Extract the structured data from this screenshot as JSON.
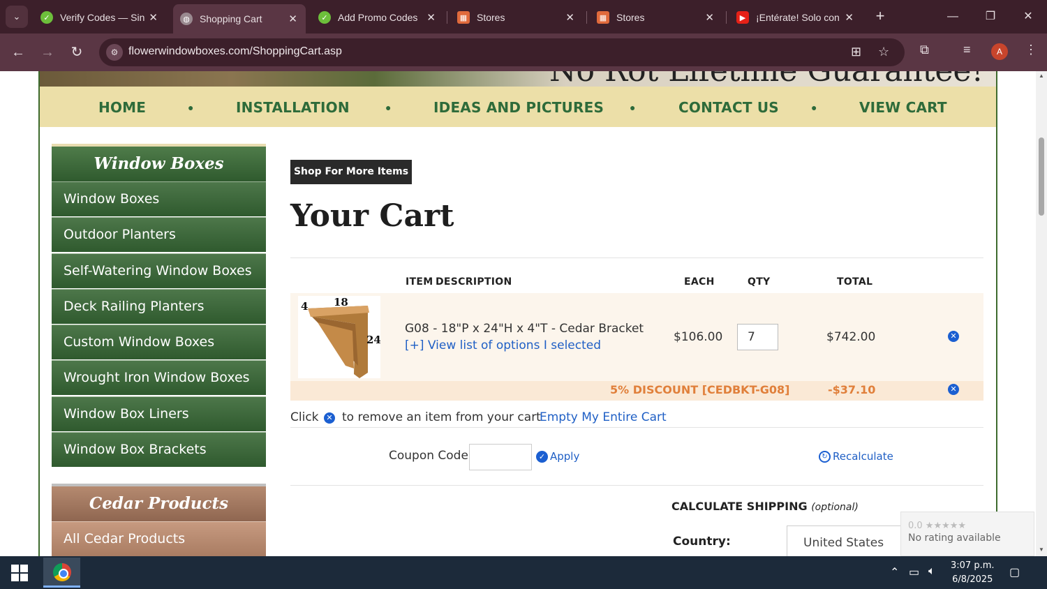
{
  "browser": {
    "tabs": [
      {
        "title": "Verify Codes — Sin",
        "favicon": "check-badge-icon",
        "active": false
      },
      {
        "title": "Shopping Cart",
        "favicon": "globe-icon",
        "active": true
      },
      {
        "title": "Add Promo Codes",
        "favicon": "check-badge-icon",
        "active": false
      },
      {
        "title": "Stores",
        "favicon": "puzzle-icon",
        "active": false
      },
      {
        "title": "Stores",
        "favicon": "puzzle-icon",
        "active": false
      },
      {
        "title": "¡Entérate! Solo con",
        "favicon": "youtube-icon",
        "active": false
      }
    ],
    "url": "flowerwindowboxes.com/ShoppingCart.asp",
    "profile_initial": "A"
  },
  "site": {
    "banner_text": "No Rot Lifetime Guarantee!",
    "nav": [
      "HOME",
      "INSTALLATION",
      "IDEAS AND PICTURES",
      "CONTACT US",
      "VIEW CART"
    ]
  },
  "sidebar": {
    "section1_title": "Window Boxes",
    "section1_items": [
      "Window Boxes",
      "Outdoor Planters",
      "Self-Watering Window Boxes",
      "Deck Railing Planters",
      "Custom Window Boxes",
      "Wrought Iron Window Boxes",
      "Window Box Liners",
      "Window Box Brackets"
    ],
    "section2_title": "Cedar Products",
    "section2_items": [
      "All Cedar Products"
    ]
  },
  "cart": {
    "shop_more": "Shop For More Items",
    "title": "Your Cart",
    "headers": {
      "item": "ITEM",
      "description": "DESCRIPTION",
      "each": "EACH",
      "qty": "QTY",
      "total": "TOTAL"
    },
    "item": {
      "thumb_labels": {
        "depth": "18",
        "thickness": "4",
        "height": "24"
      },
      "name": "G08 - 18\"P x 24\"H x 4\"T - Cedar Bracket",
      "options_link": "[+] View list of options I selected",
      "each": "$106.00",
      "qty": "7",
      "total": "$742.00"
    },
    "discount": {
      "label": "5% DISCOUNT [CEDBKT-G08]",
      "amount": "-$37.10"
    },
    "help_click": "Click",
    "help_rest": "to remove an item from your cart",
    "empty_link": "Empty My Entire Cart",
    "coupon_label": "Coupon Code:",
    "coupon_value": "",
    "apply": "Apply",
    "recalculate": "Recalculate",
    "shipping_title": "CALCULATE SHIPPING",
    "shipping_optional": "(optional)",
    "country_label": "Country:",
    "country_value": "United States"
  },
  "rating_widget": {
    "score": "0.0 ★★★★★",
    "text": "No rating available"
  },
  "taskbar": {
    "time": "3:07 p.m.",
    "date": "6/8/2025"
  },
  "colors": {
    "nav_bg": "#ecdfa8",
    "nav_text": "#2e6b3a",
    "sidebar_green": "#2f5a2e",
    "sidebar_brown": "#8f6650",
    "link": "#1f5fc5",
    "discount": "#e07f3a",
    "chrome_dark": "#3c1f2a",
    "chrome_mid": "#5a3644"
  }
}
